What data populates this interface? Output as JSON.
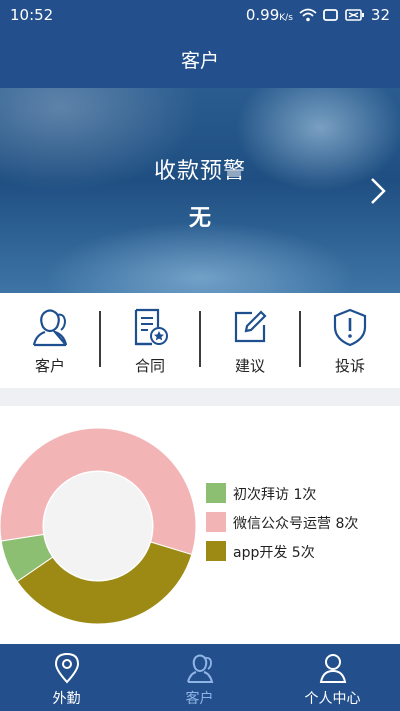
{
  "status_bar": {
    "time": "10:52",
    "network_speed": "0.99",
    "network_unit": "K/s",
    "battery": "32"
  },
  "header": {
    "title": "客户"
  },
  "banner": {
    "label": "收款预警",
    "value": "无"
  },
  "quick_actions": [
    {
      "label": "客户",
      "icon": "user-icon"
    },
    {
      "label": "合同",
      "icon": "contract-icon"
    },
    {
      "label": "建议",
      "icon": "edit-icon"
    },
    {
      "label": "投诉",
      "icon": "shield-alert-icon"
    }
  ],
  "chart_data": {
    "type": "pie",
    "variant": "donut",
    "categories": [
      "初次拜访",
      "微信公众号运营",
      "app开发"
    ],
    "values": [
      1,
      8,
      5
    ],
    "legend_labels": [
      "初次拜访 1次",
      "微信公众号运营 8次",
      "app开发 5次"
    ],
    "colors": [
      "#8dbf73",
      "#f3b4b6",
      "#9c8a14"
    ],
    "legend_position": "right"
  },
  "tab_bar": {
    "items": [
      {
        "label": "外勤",
        "icon": "location-pin-icon",
        "active": false
      },
      {
        "label": "客户",
        "icon": "users-icon",
        "active": true
      },
      {
        "label": "个人中心",
        "icon": "person-icon",
        "active": false
      }
    ],
    "active_color": "#8fb4e6",
    "inactive_color": "#ffffff"
  },
  "colors": {
    "brand": "#23508c"
  }
}
